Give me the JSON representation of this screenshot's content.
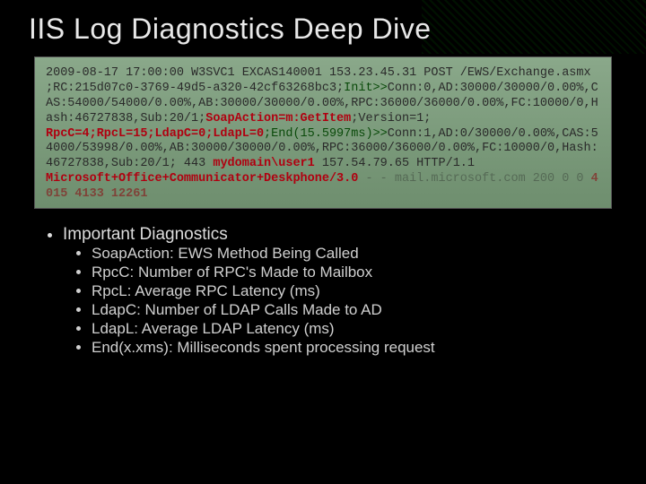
{
  "title": "IIS Log Diagnostics Deep Dive",
  "log": {
    "l1": "2009-08-17 17:00:00 W3SVC1 EXCAS140001 153.23.45.31 POST /EWS/Exchange.asmx ;RC:215d07c0-3769-49d5-a320-42cf63268bc3;",
    "l2": "Init>>",
    "l3": "Conn:0,AD:30000/30000/0.00%,CAS:54000/54000/0.00%,AB:30000/30000/0.00%,RPC:36000/36000/0.00%,FC:10000/0,Hash:46727838,Sub:20/1;",
    "l4": "SoapAction=m:GetItem",
    "l5": ";Version=1;",
    "l6": "RpcC=4;RpcL=15;LdapC=0;LdapL=0",
    "l7": ";End(15.5997ms)>>",
    "l8": "Conn:1,AD:0/30000/0.00%,CAS:54000/53998/0.00%,AB:30000/30000/0.00%,RPC:36000/36000/0.00%,FC:10000/0,Hash:46727838,Sub:20/1;  443 ",
    "l9": "mydomain\\user1",
    "l10": " 157.54.79.65 HTTP/1.1 ",
    "l11": "Microsoft+Office+Communicator+Deskphone/3.0",
    "l12": " - - mail.microsoft.com 200 0 0 ",
    "l13": "4015 4133 12261"
  },
  "diag": {
    "heading": "Important Diagnostics",
    "items": [
      "SoapAction: EWS Method Being Called",
      "RpcC: Number of RPC's Made to Mailbox",
      "RpcL: Average RPC Latency (ms)",
      "LdapC: Number of LDAP Calls Made to AD",
      "LdapL: Average LDAP Latency (ms)",
      "End(x.xms): Milliseconds spent processing request"
    ]
  }
}
